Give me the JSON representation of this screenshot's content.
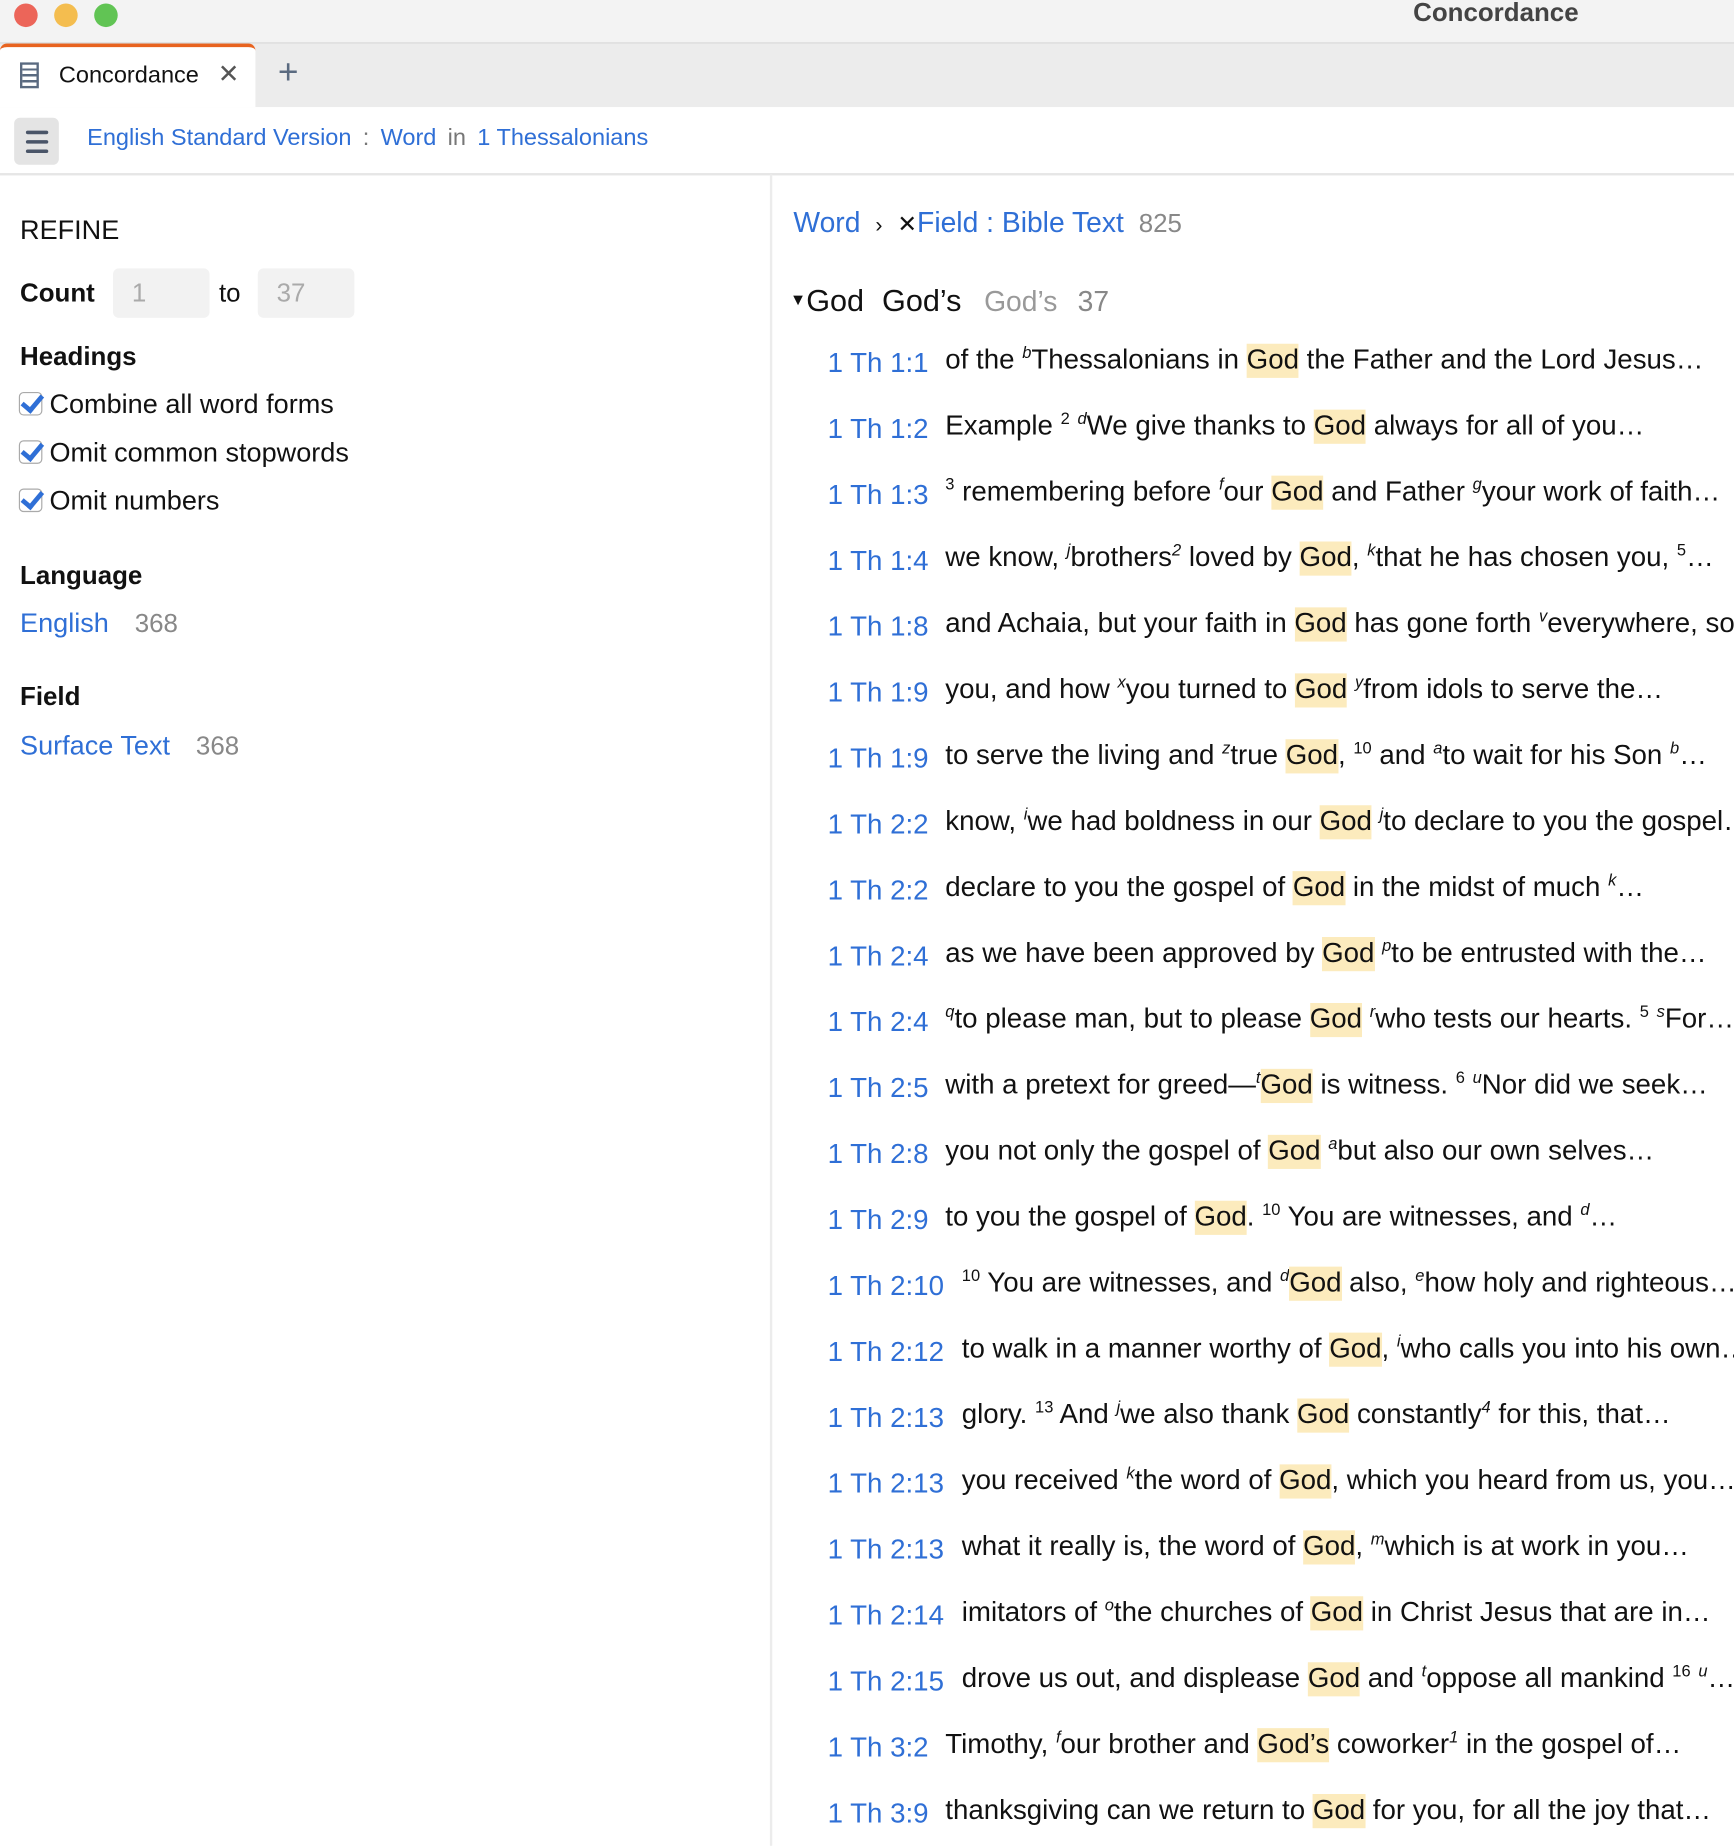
{
  "window": {
    "title": "Concordance",
    "lights": [
      "#ec6559",
      "#f4bd4f",
      "#61c454"
    ]
  },
  "tabs": [
    {
      "label": "Concordance",
      "icon": "grid-icon"
    }
  ],
  "toolbar": {
    "version": "English Standard Version",
    "sep": ":",
    "field": "Word",
    "in": "in",
    "book": "1 Thessalonians"
  },
  "refine": {
    "title": "REFINE",
    "count_label": "Count",
    "count_from": "1",
    "to": "to",
    "count_to": "37",
    "headings_label": "Headings",
    "options": [
      "Combine all word forms",
      "Omit common stopwords",
      "Omit numbers"
    ],
    "language_label": "Language",
    "language": {
      "value": "English",
      "count": "368"
    },
    "field_label": "Field",
    "field": {
      "value": "Surface Text",
      "count": "368"
    }
  },
  "results": {
    "crumb_word": "Word",
    "crumb_sep": "›",
    "crumb_remove": "✕",
    "crumb_field": "Field : Bible Text",
    "crumb_count": "825",
    "group": {
      "forms": [
        "God",
        "God’s"
      ],
      "alt": "God’s",
      "count": "37"
    },
    "accent": "#2f6fd6",
    "highlight": "#fcebbd",
    "rows": [
      {
        "ref": "1 Th 1:1",
        "seg": [
          [
            "t",
            "of the "
          ],
          [
            "s",
            "b"
          ],
          [
            "t",
            "Thessalonians in "
          ],
          [
            "h",
            "God"
          ],
          [
            "t",
            " the Father and the Lord Jesus…"
          ]
        ]
      },
      {
        "ref": "1 Th 1:2",
        "seg": [
          [
            "t",
            "Example "
          ],
          [
            "n",
            "2"
          ],
          [
            "t",
            " "
          ],
          [
            "s",
            "d"
          ],
          [
            "t",
            "We give thanks to "
          ],
          [
            "h",
            "God"
          ],
          [
            "t",
            " always for all of you…"
          ]
        ]
      },
      {
        "ref": "1 Th 1:3",
        "seg": [
          [
            "n",
            "3"
          ],
          [
            "t",
            " remembering before "
          ],
          [
            "s",
            "f"
          ],
          [
            "t",
            "our "
          ],
          [
            "h",
            "God"
          ],
          [
            "t",
            " and Father "
          ],
          [
            "s",
            "g"
          ],
          [
            "t",
            "your work of faith…"
          ]
        ]
      },
      {
        "ref": "1 Th 1:4",
        "seg": [
          [
            "t",
            "we know, "
          ],
          [
            "s",
            "j"
          ],
          [
            "t",
            "brothers"
          ],
          [
            "s",
            "2"
          ],
          [
            "t",
            " loved by "
          ],
          [
            "h",
            "God"
          ],
          [
            "t",
            ", "
          ],
          [
            "s",
            "k"
          ],
          [
            "t",
            "that he has chosen you, "
          ],
          [
            "n",
            "5"
          ],
          [
            "t",
            "…"
          ]
        ]
      },
      {
        "ref": "1 Th 1:8",
        "seg": [
          [
            "t",
            "and Achaia, but your faith in "
          ],
          [
            "h",
            "God"
          ],
          [
            "t",
            " has gone forth "
          ],
          [
            "s",
            "v"
          ],
          [
            "t",
            "everywhere, so…"
          ]
        ]
      },
      {
        "ref": "1 Th 1:9",
        "seg": [
          [
            "t",
            "you, and how "
          ],
          [
            "s",
            "x"
          ],
          [
            "t",
            "you turned to "
          ],
          [
            "h",
            "God"
          ],
          [
            "t",
            " "
          ],
          [
            "s",
            "y"
          ],
          [
            "t",
            "from idols to serve the…"
          ]
        ]
      },
      {
        "ref": "1 Th 1:9",
        "seg": [
          [
            "t",
            "to serve the living and "
          ],
          [
            "s",
            "z"
          ],
          [
            "t",
            "true "
          ],
          [
            "h",
            "God"
          ],
          [
            "t",
            ", "
          ],
          [
            "n",
            "10"
          ],
          [
            "t",
            " and "
          ],
          [
            "s",
            "a"
          ],
          [
            "t",
            "to wait for his Son "
          ],
          [
            "s",
            "b"
          ],
          [
            "t",
            "…"
          ]
        ]
      },
      {
        "ref": "1 Th 2:2",
        "seg": [
          [
            "t",
            "know, "
          ],
          [
            "s",
            "i"
          ],
          [
            "t",
            "we had boldness in our "
          ],
          [
            "h",
            "God"
          ],
          [
            "t",
            " "
          ],
          [
            "s",
            "j"
          ],
          [
            "t",
            "to declare to you the gospel…"
          ]
        ]
      },
      {
        "ref": "1 Th 2:2",
        "seg": [
          [
            "t",
            "declare to you the gospel of "
          ],
          [
            "h",
            "God"
          ],
          [
            "t",
            " in the midst of much "
          ],
          [
            "s",
            "k"
          ],
          [
            "t",
            "…"
          ]
        ]
      },
      {
        "ref": "1 Th 2:4",
        "seg": [
          [
            "t",
            "as we have been approved by "
          ],
          [
            "h",
            "God"
          ],
          [
            "t",
            " "
          ],
          [
            "s",
            "p"
          ],
          [
            "t",
            "to be entrusted with the…"
          ]
        ]
      },
      {
        "ref": "1 Th 2:4",
        "seg": [
          [
            "s",
            "q"
          ],
          [
            "t",
            "to please man, but to please "
          ],
          [
            "h",
            "God"
          ],
          [
            "t",
            " "
          ],
          [
            "s",
            "r"
          ],
          [
            "t",
            "who tests our hearts. "
          ],
          [
            "n",
            "5"
          ],
          [
            "t",
            " "
          ],
          [
            "s",
            "s"
          ],
          [
            "t",
            "For…"
          ]
        ]
      },
      {
        "ref": "1 Th 2:5",
        "seg": [
          [
            "t",
            "with a pretext for greed—"
          ],
          [
            "s",
            "t"
          ],
          [
            "h",
            "God"
          ],
          [
            "t",
            " is witness. "
          ],
          [
            "n",
            "6"
          ],
          [
            "t",
            " "
          ],
          [
            "s",
            "u"
          ],
          [
            "t",
            "Nor did we seek…"
          ]
        ]
      },
      {
        "ref": "1 Th 2:8",
        "seg": [
          [
            "t",
            "you not only the gospel of "
          ],
          [
            "h",
            "God"
          ],
          [
            "t",
            " "
          ],
          [
            "s",
            "a"
          ],
          [
            "t",
            "but also our own selves…"
          ]
        ]
      },
      {
        "ref": "1 Th 2:9",
        "seg": [
          [
            "t",
            "to you the gospel of "
          ],
          [
            "h",
            "God"
          ],
          [
            "t",
            ". "
          ],
          [
            "n",
            "10"
          ],
          [
            "t",
            " You are witnesses, and "
          ],
          [
            "s",
            "d"
          ],
          [
            "t",
            "…"
          ]
        ]
      },
      {
        "ref": "1 Th 2:10",
        "seg": [
          [
            "n",
            "10"
          ],
          [
            "t",
            " You are witnesses, and "
          ],
          [
            "s",
            "d"
          ],
          [
            "h",
            "God"
          ],
          [
            "t",
            " also, "
          ],
          [
            "s",
            "e"
          ],
          [
            "t",
            "how holy and righteous…"
          ]
        ]
      },
      {
        "ref": "1 Th 2:12",
        "seg": [
          [
            "t",
            "to walk in a manner worthy of "
          ],
          [
            "h",
            "God"
          ],
          [
            "t",
            ", "
          ],
          [
            "s",
            "i"
          ],
          [
            "t",
            "who calls you into his own…"
          ]
        ]
      },
      {
        "ref": "1 Th 2:13",
        "seg": [
          [
            "t",
            "glory. "
          ],
          [
            "n",
            "13"
          ],
          [
            "t",
            " And "
          ],
          [
            "s",
            "j"
          ],
          [
            "t",
            "we also thank "
          ],
          [
            "h",
            "God"
          ],
          [
            "t",
            " constantly"
          ],
          [
            "s",
            "4"
          ],
          [
            "t",
            " for this, that…"
          ]
        ]
      },
      {
        "ref": "1 Th 2:13",
        "seg": [
          [
            "t",
            "you received "
          ],
          [
            "s",
            "k"
          ],
          [
            "t",
            "the word of "
          ],
          [
            "h",
            "God"
          ],
          [
            "t",
            ", which you heard from us, you…"
          ]
        ]
      },
      {
        "ref": "1 Th 2:13",
        "seg": [
          [
            "t",
            "what it really is, the word of "
          ],
          [
            "h",
            "God"
          ],
          [
            "t",
            ", "
          ],
          [
            "s",
            "m"
          ],
          [
            "t",
            "which is at work in you…"
          ]
        ]
      },
      {
        "ref": "1 Th 2:14",
        "seg": [
          [
            "t",
            "imitators of "
          ],
          [
            "s",
            "o"
          ],
          [
            "t",
            "the churches of "
          ],
          [
            "h",
            "God"
          ],
          [
            "t",
            " in Christ Jesus that are in…"
          ]
        ]
      },
      {
        "ref": "1 Th 2:15",
        "seg": [
          [
            "t",
            "drove us out, and displease "
          ],
          [
            "h",
            "God"
          ],
          [
            "t",
            " and "
          ],
          [
            "s",
            "t"
          ],
          [
            "t",
            "oppose all mankind "
          ],
          [
            "n",
            "16"
          ],
          [
            "t",
            " "
          ],
          [
            "s",
            "u"
          ],
          [
            "t",
            "…"
          ]
        ]
      },
      {
        "ref": "1 Th 3:2",
        "seg": [
          [
            "t",
            "Timothy, "
          ],
          [
            "s",
            "f"
          ],
          [
            "t",
            "our brother and "
          ],
          [
            "h",
            "God’s"
          ],
          [
            "t",
            " coworker"
          ],
          [
            "s",
            "1"
          ],
          [
            "t",
            " in the gospel of…"
          ]
        ]
      },
      {
        "ref": "1 Th 3:9",
        "seg": [
          [
            "t",
            "thanksgiving can we return to "
          ],
          [
            "h",
            "God"
          ],
          [
            "t",
            " for you, for all the joy that…"
          ]
        ]
      }
    ]
  }
}
